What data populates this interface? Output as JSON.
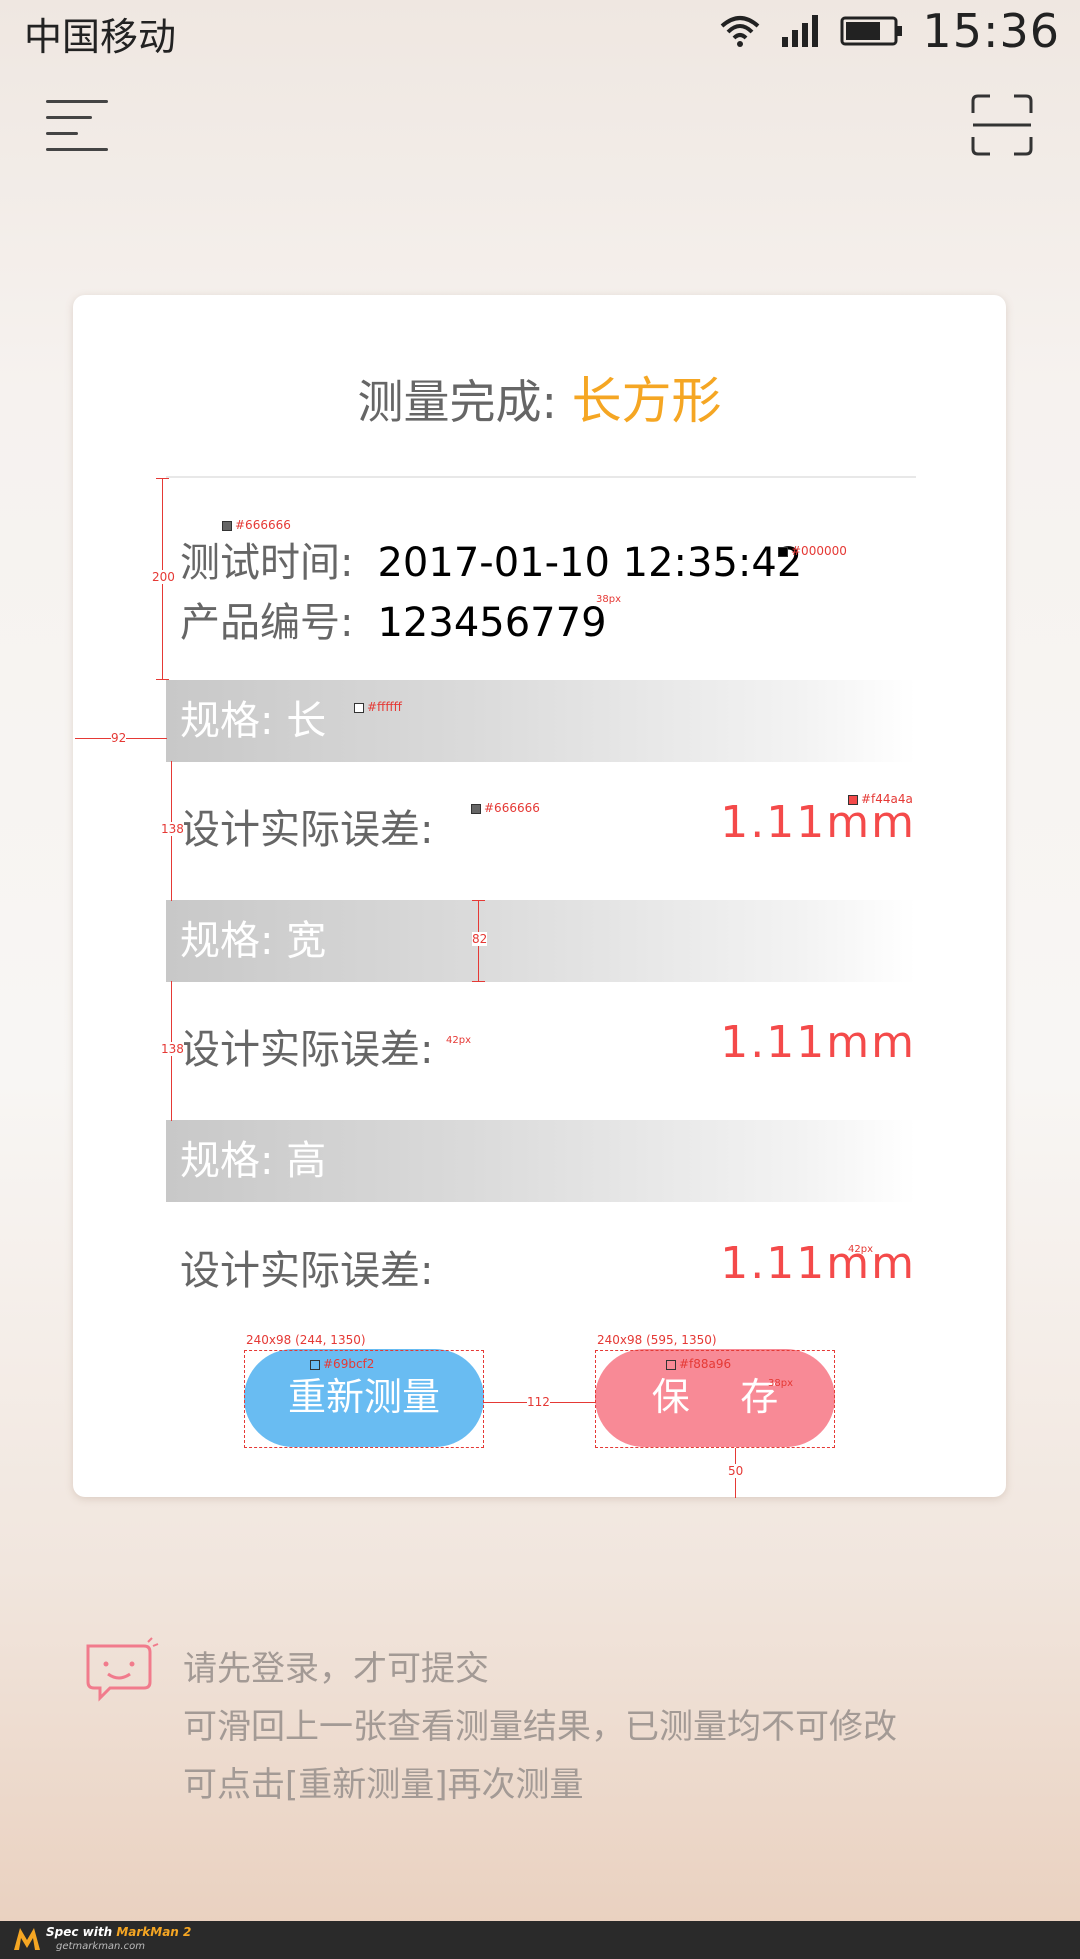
{
  "status_bar": {
    "carrier": "中国移动",
    "time": "15:36"
  },
  "card": {
    "title_prefix": "测量完成:",
    "title_shape": "长方形",
    "test_time_label": "测试时间:",
    "test_time_value": "2017-01-10  12:35:42",
    "product_no_label": "产品编号:",
    "product_no_value": "123456779",
    "specs": [
      {
        "label": "规格:  长",
        "error_label": "设计实际误差:",
        "error_value": "1.11mm"
      },
      {
        "label": "规格:  宽",
        "error_label": "设计实际误差:",
        "error_value": "1.11mm"
      },
      {
        "label": "规格:  高",
        "error_label": "设计实际误差:",
        "error_value": "1.11mm"
      }
    ],
    "buttons": {
      "remeasure": "重新测量",
      "save": "保 存"
    }
  },
  "annotations": {
    "c666_a": "#666666",
    "c000": "#000000",
    "px38_a": "38px",
    "cfff": "#ffffff",
    "c666_b": "#666666",
    "cf44": "#f44a4a",
    "px42_a": "42px",
    "px42_b": "42px",
    "c69b": "#69bcf2",
    "cf88": "#f88a96",
    "px38_b": "38px",
    "box1": "240x98 (244, 1350)",
    "box2": "240x98 (595, 1350)",
    "d200": "200",
    "d92": "92",
    "d138_a": "138",
    "d82": "82",
    "d138_b": "138",
    "d112": "112",
    "d50": "50"
  },
  "tips": [
    "请先登录，才可提交",
    "可滑回上一张查看测量结果，已测量均不可修改",
    "可点击[重新测量]再次测量"
  ],
  "footer": {
    "brand_prefix": "Spec with ",
    "brand": "MarkMan 2",
    "site": "getmarkman.com"
  },
  "colors": {
    "label_gray": "#666666",
    "value_black": "#000000",
    "accent_orange": "#f5a623",
    "error_red": "#f44a4a",
    "remeasure_blue": "#69bcf2",
    "save_pink": "#f88a96"
  }
}
